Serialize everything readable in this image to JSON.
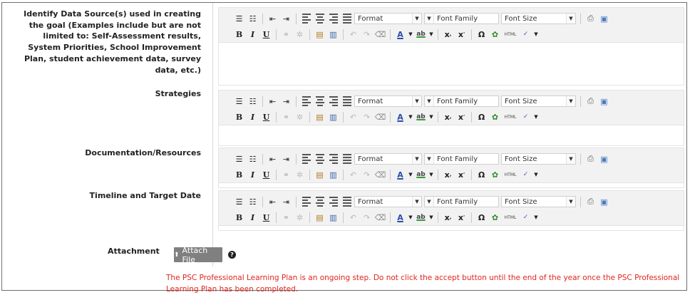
{
  "fields": [
    {
      "label": "Identify Data Source(s) used in creating the goal (Examples include but are not limited to: Self-Assessment results, System Priorities, School Improvement Plan, student achievement data, survey data, etc.)"
    },
    {
      "label": "Strategies"
    },
    {
      "label": "Documentation/Resources"
    },
    {
      "label": "Timeline and Target Date"
    }
  ],
  "toolbar": {
    "format": "Format",
    "font_family": "Font Family",
    "font_size": "Font Size",
    "bold": "B",
    "italic": "I",
    "underline": "U",
    "html": "HTML",
    "subscript": "x",
    "superscript": "x",
    "omega": "Ω"
  },
  "attachment": {
    "label": "Attachment",
    "button": "Attach File"
  },
  "note": "The PSC Professional Learning Plan is an ongoing step.  Do not click the accept button until the end of the year once the PSC Professional Learning Plan has been completed.",
  "colors": {
    "note": "#e0251c",
    "button": "#808080"
  }
}
